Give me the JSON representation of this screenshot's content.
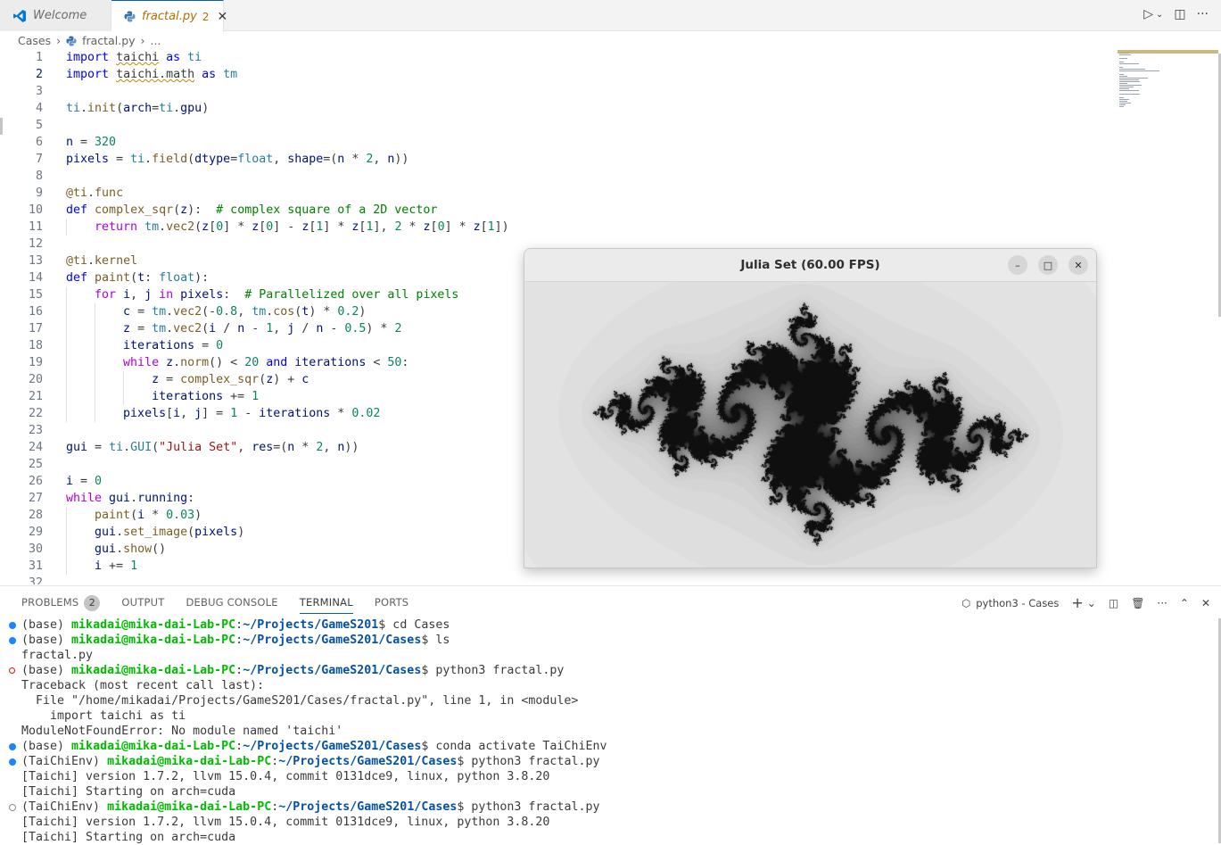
{
  "tabs": [
    {
      "label": "Welcome"
    },
    {
      "label": "fractal.py",
      "badge": "2"
    }
  ],
  "breadcrumb": {
    "folder": "Cases",
    "file": "fractal.py",
    "more": "..."
  },
  "code_lines": [
    {
      "n": "1"
    },
    {
      "n": "2"
    },
    {
      "n": "3"
    },
    {
      "n": "4"
    },
    {
      "n": "5"
    },
    {
      "n": "6"
    },
    {
      "n": "7"
    },
    {
      "n": "8"
    },
    {
      "n": "9"
    },
    {
      "n": "10"
    },
    {
      "n": "11"
    },
    {
      "n": "12"
    },
    {
      "n": "13"
    },
    {
      "n": "14"
    },
    {
      "n": "15"
    },
    {
      "n": "16"
    },
    {
      "n": "17"
    },
    {
      "n": "18"
    },
    {
      "n": "19"
    },
    {
      "n": "20"
    },
    {
      "n": "21"
    },
    {
      "n": "22"
    },
    {
      "n": "23"
    },
    {
      "n": "24"
    },
    {
      "n": "25"
    },
    {
      "n": "26"
    },
    {
      "n": "27"
    },
    {
      "n": "28"
    },
    {
      "n": "29"
    },
    {
      "n": "30"
    },
    {
      "n": "31"
    },
    {
      "n": "32"
    }
  ],
  "code": {
    "l1": [
      [
        "kw",
        "import"
      ],
      [
        "t",
        " "
      ],
      [
        "sq",
        "taichi"
      ],
      [
        "t",
        " "
      ],
      [
        "kw",
        "as"
      ],
      [
        "t",
        " "
      ],
      [
        "cls",
        "ti"
      ]
    ],
    "l2": [
      [
        "kw",
        "import"
      ],
      [
        "t",
        " "
      ],
      [
        "sq",
        "taichi.math"
      ],
      [
        "t",
        " "
      ],
      [
        "kw",
        "as"
      ],
      [
        "t",
        " "
      ],
      [
        "cls",
        "tm"
      ]
    ],
    "l4": [
      [
        "cls",
        "ti"
      ],
      [
        "t",
        "."
      ],
      [
        "fn",
        "init"
      ],
      [
        "t",
        "("
      ],
      [
        "var",
        "arch"
      ],
      [
        "t",
        "="
      ],
      [
        "cls",
        "ti"
      ],
      [
        "t",
        "."
      ],
      [
        "var",
        "gpu"
      ],
      [
        "t",
        ")"
      ]
    ],
    "l6": [
      [
        "var",
        "n"
      ],
      [
        "t",
        " = "
      ],
      [
        "num",
        "320"
      ]
    ],
    "l7": [
      [
        "var",
        "pixels"
      ],
      [
        "t",
        " = "
      ],
      [
        "cls",
        "ti"
      ],
      [
        "t",
        "."
      ],
      [
        "fn",
        "field"
      ],
      [
        "t",
        "("
      ],
      [
        "var",
        "dtype"
      ],
      [
        "t",
        "="
      ],
      [
        "cls",
        "float"
      ],
      [
        "t",
        ", "
      ],
      [
        "var",
        "shape"
      ],
      [
        "t",
        "=("
      ],
      [
        "var",
        "n"
      ],
      [
        "t",
        " * "
      ],
      [
        "num",
        "2"
      ],
      [
        "t",
        ", "
      ],
      [
        "var",
        "n"
      ],
      [
        "t",
        "))"
      ]
    ],
    "l9": [
      [
        "fn",
        "@ti"
      ],
      [
        "t",
        "."
      ],
      [
        "fn",
        "func"
      ]
    ],
    "l10": [
      [
        "kw",
        "def"
      ],
      [
        "t",
        " "
      ],
      [
        "fn",
        "complex_sqr"
      ],
      [
        "t",
        "("
      ],
      [
        "var",
        "z"
      ],
      [
        "t",
        "):  "
      ],
      [
        "cmt",
        "# complex square of a 2D vector"
      ]
    ],
    "l11": [
      [
        "t",
        "    "
      ],
      [
        "ctl",
        "return"
      ],
      [
        "t",
        " "
      ],
      [
        "cls",
        "tm"
      ],
      [
        "t",
        "."
      ],
      [
        "fn",
        "vec2"
      ],
      [
        "t",
        "("
      ],
      [
        "var",
        "z"
      ],
      [
        "t",
        "["
      ],
      [
        "num",
        "0"
      ],
      [
        "t",
        "] * "
      ],
      [
        "var",
        "z"
      ],
      [
        "t",
        "["
      ],
      [
        "num",
        "0"
      ],
      [
        "t",
        "] - "
      ],
      [
        "var",
        "z"
      ],
      [
        "t",
        "["
      ],
      [
        "num",
        "1"
      ],
      [
        "t",
        "] * "
      ],
      [
        "var",
        "z"
      ],
      [
        "t",
        "["
      ],
      [
        "num",
        "1"
      ],
      [
        "t",
        "], "
      ],
      [
        "num",
        "2"
      ],
      [
        "t",
        " * "
      ],
      [
        "var",
        "z"
      ],
      [
        "t",
        "["
      ],
      [
        "num",
        "0"
      ],
      [
        "t",
        "] * "
      ],
      [
        "var",
        "z"
      ],
      [
        "t",
        "["
      ],
      [
        "num",
        "1"
      ],
      [
        "t",
        "])"
      ]
    ],
    "l13": [
      [
        "fn",
        "@ti"
      ],
      [
        "t",
        "."
      ],
      [
        "fn",
        "kernel"
      ]
    ],
    "l14": [
      [
        "kw",
        "def"
      ],
      [
        "t",
        " "
      ],
      [
        "fn",
        "paint"
      ],
      [
        "t",
        "("
      ],
      [
        "var",
        "t"
      ],
      [
        "t",
        ": "
      ],
      [
        "cls",
        "float"
      ],
      [
        "t",
        "):"
      ]
    ],
    "l15": [
      [
        "t",
        "    "
      ],
      [
        "ctl",
        "for"
      ],
      [
        "t",
        " "
      ],
      [
        "var",
        "i"
      ],
      [
        "t",
        ", "
      ],
      [
        "var",
        "j"
      ],
      [
        "t",
        " "
      ],
      [
        "ctl",
        "in"
      ],
      [
        "t",
        " "
      ],
      [
        "var",
        "pixels"
      ],
      [
        "t",
        ":  "
      ],
      [
        "cmt",
        "# Parallelized over all pixels"
      ]
    ],
    "l16": [
      [
        "t",
        "        "
      ],
      [
        "var",
        "c"
      ],
      [
        "t",
        " = "
      ],
      [
        "cls",
        "tm"
      ],
      [
        "t",
        "."
      ],
      [
        "fn",
        "vec2"
      ],
      [
        "t",
        "(-"
      ],
      [
        "num",
        "0.8"
      ],
      [
        "t",
        ", "
      ],
      [
        "cls",
        "tm"
      ],
      [
        "t",
        "."
      ],
      [
        "fn",
        "cos"
      ],
      [
        "t",
        "("
      ],
      [
        "var",
        "t"
      ],
      [
        "t",
        ") * "
      ],
      [
        "num",
        "0.2"
      ],
      [
        "t",
        ")"
      ]
    ],
    "l17": [
      [
        "t",
        "        "
      ],
      [
        "var",
        "z"
      ],
      [
        "t",
        " = "
      ],
      [
        "cls",
        "tm"
      ],
      [
        "t",
        "."
      ],
      [
        "fn",
        "vec2"
      ],
      [
        "t",
        "("
      ],
      [
        "var",
        "i"
      ],
      [
        "t",
        " / "
      ],
      [
        "var",
        "n"
      ],
      [
        "t",
        " - "
      ],
      [
        "num",
        "1"
      ],
      [
        "t",
        ", "
      ],
      [
        "var",
        "j"
      ],
      [
        "t",
        " / "
      ],
      [
        "var",
        "n"
      ],
      [
        "t",
        " - "
      ],
      [
        "num",
        "0.5"
      ],
      [
        "t",
        ") * "
      ],
      [
        "num",
        "2"
      ]
    ],
    "l18": [
      [
        "t",
        "        "
      ],
      [
        "var",
        "iterations"
      ],
      [
        "t",
        " = "
      ],
      [
        "num",
        "0"
      ]
    ],
    "l19": [
      [
        "t",
        "        "
      ],
      [
        "ctl",
        "while"
      ],
      [
        "t",
        " "
      ],
      [
        "var",
        "z"
      ],
      [
        "t",
        "."
      ],
      [
        "fn",
        "norm"
      ],
      [
        "t",
        "() < "
      ],
      [
        "num",
        "20"
      ],
      [
        "t",
        " "
      ],
      [
        "kw",
        "and"
      ],
      [
        "t",
        " "
      ],
      [
        "var",
        "iterations"
      ],
      [
        "t",
        " < "
      ],
      [
        "num",
        "50"
      ],
      [
        "t",
        ":"
      ]
    ],
    "l20": [
      [
        "t",
        "            "
      ],
      [
        "var",
        "z"
      ],
      [
        "t",
        " = "
      ],
      [
        "fn",
        "complex_sqr"
      ],
      [
        "t",
        "("
      ],
      [
        "var",
        "z"
      ],
      [
        "t",
        ") + "
      ],
      [
        "var",
        "c"
      ]
    ],
    "l21": [
      [
        "t",
        "            "
      ],
      [
        "var",
        "iterations"
      ],
      [
        "t",
        " += "
      ],
      [
        "num",
        "1"
      ]
    ],
    "l22": [
      [
        "t",
        "        "
      ],
      [
        "var",
        "pixels"
      ],
      [
        "t",
        "["
      ],
      [
        "var",
        "i"
      ],
      [
        "t",
        ", "
      ],
      [
        "var",
        "j"
      ],
      [
        "t",
        "] = "
      ],
      [
        "num",
        "1"
      ],
      [
        "t",
        " - "
      ],
      [
        "var",
        "iterations"
      ],
      [
        "t",
        " * "
      ],
      [
        "num",
        "0.02"
      ]
    ],
    "l24": [
      [
        "var",
        "gui"
      ],
      [
        "t",
        " = "
      ],
      [
        "cls",
        "ti"
      ],
      [
        "t",
        "."
      ],
      [
        "cls",
        "GUI"
      ],
      [
        "t",
        "("
      ],
      [
        "str",
        "\"Julia Set\""
      ],
      [
        "t",
        ", "
      ],
      [
        "var",
        "res"
      ],
      [
        "t",
        "=("
      ],
      [
        "var",
        "n"
      ],
      [
        "t",
        " * "
      ],
      [
        "num",
        "2"
      ],
      [
        "t",
        ", "
      ],
      [
        "var",
        "n"
      ],
      [
        "t",
        "))"
      ]
    ],
    "l26": [
      [
        "var",
        "i"
      ],
      [
        "t",
        " = "
      ],
      [
        "num",
        "0"
      ]
    ],
    "l27": [
      [
        "ctl",
        "while"
      ],
      [
        "t",
        " "
      ],
      [
        "var",
        "gui"
      ],
      [
        "t",
        "."
      ],
      [
        "var",
        "running"
      ],
      [
        "t",
        ":"
      ]
    ],
    "l28": [
      [
        "t",
        "    "
      ],
      [
        "fn",
        "paint"
      ],
      [
        "t",
        "("
      ],
      [
        "var",
        "i"
      ],
      [
        "t",
        " * "
      ],
      [
        "num",
        "0.03"
      ],
      [
        "t",
        ")"
      ]
    ],
    "l29": [
      [
        "t",
        "    "
      ],
      [
        "var",
        "gui"
      ],
      [
        "t",
        "."
      ],
      [
        "fn",
        "set_image"
      ],
      [
        "t",
        "("
      ],
      [
        "var",
        "pixels"
      ],
      [
        "t",
        ")"
      ]
    ],
    "l30": [
      [
        "t",
        "    "
      ],
      [
        "var",
        "gui"
      ],
      [
        "t",
        "."
      ],
      [
        "fn",
        "show"
      ],
      [
        "t",
        "()"
      ]
    ],
    "l31": [
      [
        "t",
        "    "
      ],
      [
        "var",
        "i"
      ],
      [
        "t",
        " += "
      ],
      [
        "num",
        "1"
      ]
    ]
  },
  "julia_window": {
    "title": "Julia Set (60.00 FPS)",
    "minimize": "–",
    "maximize": "□",
    "close": "✕"
  },
  "panel": {
    "tabs": [
      "PROBLEMS",
      "OUTPUT",
      "DEBUG CONSOLE",
      "TERMINAL",
      "PORTS"
    ],
    "problems_count": "2",
    "shell": "python3 - Cases"
  },
  "terminal": {
    "lines": [
      {
        "dot": "blue",
        "parts": [
          [
            "t",
            "(base) "
          ],
          [
            "user",
            "mikadai@mika-dai-Lab-PC"
          ],
          [
            "t",
            ":"
          ],
          [
            "path",
            "~/Projects/GameS201"
          ],
          [
            "t",
            "$ cd Cases"
          ]
        ]
      },
      {
        "dot": "blue",
        "parts": [
          [
            "t",
            "(base) "
          ],
          [
            "user",
            "mikadai@mika-dai-Lab-PC"
          ],
          [
            "t",
            ":"
          ],
          [
            "path",
            "~/Projects/GameS201/Cases"
          ],
          [
            "t",
            "$ ls"
          ]
        ]
      },
      {
        "dot": "",
        "parts": [
          [
            "t",
            "fractal.py"
          ]
        ]
      },
      {
        "dot": "red",
        "parts": [
          [
            "t",
            "(base) "
          ],
          [
            "user",
            "mikadai@mika-dai-Lab-PC"
          ],
          [
            "t",
            ":"
          ],
          [
            "path",
            "~/Projects/GameS201/Cases"
          ],
          [
            "t",
            "$ python3 fractal.py"
          ]
        ]
      },
      {
        "dot": "",
        "parts": [
          [
            "t",
            "Traceback (most recent call last):"
          ]
        ]
      },
      {
        "dot": "",
        "parts": [
          [
            "t",
            "  File \"/home/mikadai/Projects/GameS201/Cases/fractal.py\", line 1, in <module>"
          ]
        ]
      },
      {
        "dot": "",
        "parts": [
          [
            "t",
            "    import taichi as ti"
          ]
        ]
      },
      {
        "dot": "",
        "parts": [
          [
            "t",
            "ModuleNotFoundError: No module named 'taichi'"
          ]
        ]
      },
      {
        "dot": "blue",
        "parts": [
          [
            "t",
            "(base) "
          ],
          [
            "user",
            "mikadai@mika-dai-Lab-PC"
          ],
          [
            "t",
            ":"
          ],
          [
            "path",
            "~/Projects/GameS201/Cases"
          ],
          [
            "t",
            "$ conda activate TaiChiEnv"
          ]
        ]
      },
      {
        "dot": "blue",
        "parts": [
          [
            "t",
            "(TaiChiEnv) "
          ],
          [
            "user",
            "mikadai@mika-dai-Lab-PC"
          ],
          [
            "t",
            ":"
          ],
          [
            "path",
            "~/Projects/GameS201/Cases"
          ],
          [
            "t",
            "$ python3 fractal.py"
          ]
        ]
      },
      {
        "dot": "",
        "parts": [
          [
            "t",
            "[Taichi] version 1.7.2, llvm 15.0.4, commit 0131dce9, linux, python 3.8.20"
          ]
        ]
      },
      {
        "dot": "",
        "parts": [
          [
            "t",
            "[Taichi] Starting on arch=cuda"
          ]
        ]
      },
      {
        "dot": "hollow",
        "parts": [
          [
            "t",
            "(TaiChiEnv) "
          ],
          [
            "user",
            "mikadai@mika-dai-Lab-PC"
          ],
          [
            "t",
            ":"
          ],
          [
            "path",
            "~/Projects/GameS201/Cases"
          ],
          [
            "t",
            "$ python3 fractal.py"
          ]
        ]
      },
      {
        "dot": "",
        "parts": [
          [
            "t",
            "[Taichi] version 1.7.2, llvm 15.0.4, commit 0131dce9, linux, python 3.8.20"
          ]
        ]
      },
      {
        "dot": "",
        "parts": [
          [
            "t",
            "[Taichi] Starting on arch=cuda"
          ]
        ]
      }
    ]
  }
}
